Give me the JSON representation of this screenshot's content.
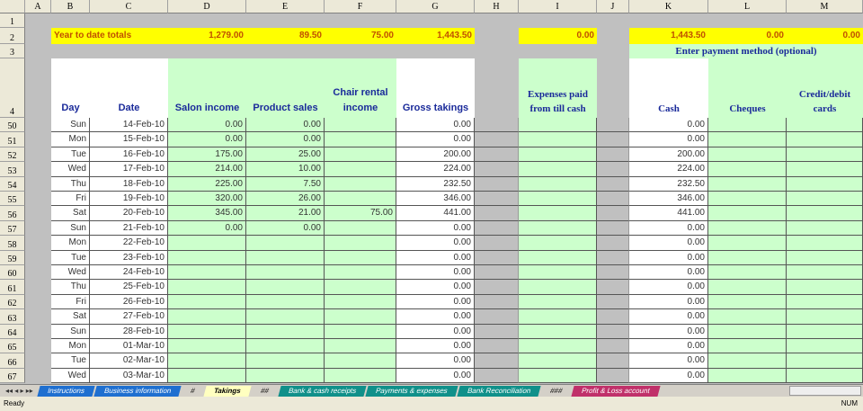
{
  "columns": [
    "A",
    "B",
    "C",
    "D",
    "E",
    "F",
    "G",
    "H",
    "I",
    "J",
    "K",
    "L",
    "M"
  ],
  "totals": {
    "label": "Year to date totals",
    "salon": "1,279.00",
    "product": "89.50",
    "chair": "75.00",
    "gross": "1,443.50",
    "expenses": "0.00",
    "cash": "1,443.50",
    "cheques": "0.00",
    "cards": "0.00"
  },
  "payment_note": "Enter payment method (optional)",
  "headers": {
    "day": "Day",
    "date": "Date",
    "salon": "Salon income",
    "product": "Product sales",
    "chair": "Chair rental income",
    "gross": "Gross takings",
    "expenses": "Expenses paid from till cash",
    "cash": "Cash",
    "cheques": "Cheques",
    "cards": "Credit/debit cards"
  },
  "header_row_numbers": [
    "1",
    "2",
    "3",
    "4"
  ],
  "rows": [
    {
      "n": "50",
      "day": "Sun",
      "date": "14-Feb-10",
      "salon": "0.00",
      "product": "0.00",
      "chair": "",
      "gross": "0.00",
      "cash": "0.00"
    },
    {
      "n": "51",
      "day": "Mon",
      "date": "15-Feb-10",
      "salon": "0.00",
      "product": "0.00",
      "chair": "",
      "gross": "0.00",
      "cash": "0.00"
    },
    {
      "n": "52",
      "day": "Tue",
      "date": "16-Feb-10",
      "salon": "175.00",
      "product": "25.00",
      "chair": "",
      "gross": "200.00",
      "cash": "200.00"
    },
    {
      "n": "53",
      "day": "Wed",
      "date": "17-Feb-10",
      "salon": "214.00",
      "product": "10.00",
      "chair": "",
      "gross": "224.00",
      "cash": "224.00"
    },
    {
      "n": "54",
      "day": "Thu",
      "date": "18-Feb-10",
      "salon": "225.00",
      "product": "7.50",
      "chair": "",
      "gross": "232.50",
      "cash": "232.50"
    },
    {
      "n": "55",
      "day": "Fri",
      "date": "19-Feb-10",
      "salon": "320.00",
      "product": "26.00",
      "chair": "",
      "gross": "346.00",
      "cash": "346.00"
    },
    {
      "n": "56",
      "day": "Sat",
      "date": "20-Feb-10",
      "salon": "345.00",
      "product": "21.00",
      "chair": "75.00",
      "gross": "441.00",
      "cash": "441.00"
    },
    {
      "n": "57",
      "day": "Sun",
      "date": "21-Feb-10",
      "salon": "0.00",
      "product": "0.00",
      "chair": "",
      "gross": "0.00",
      "cash": "0.00"
    },
    {
      "n": "58",
      "day": "Mon",
      "date": "22-Feb-10",
      "salon": "",
      "product": "",
      "chair": "",
      "gross": "0.00",
      "cash": "0.00"
    },
    {
      "n": "59",
      "day": "Tue",
      "date": "23-Feb-10",
      "salon": "",
      "product": "",
      "chair": "",
      "gross": "0.00",
      "cash": "0.00"
    },
    {
      "n": "60",
      "day": "Wed",
      "date": "24-Feb-10",
      "salon": "",
      "product": "",
      "chair": "",
      "gross": "0.00",
      "cash": "0.00"
    },
    {
      "n": "61",
      "day": "Thu",
      "date": "25-Feb-10",
      "salon": "",
      "product": "",
      "chair": "",
      "gross": "0.00",
      "cash": "0.00"
    },
    {
      "n": "62",
      "day": "Fri",
      "date": "26-Feb-10",
      "salon": "",
      "product": "",
      "chair": "",
      "gross": "0.00",
      "cash": "0.00"
    },
    {
      "n": "63",
      "day": "Sat",
      "date": "27-Feb-10",
      "salon": "",
      "product": "",
      "chair": "",
      "gross": "0.00",
      "cash": "0.00"
    },
    {
      "n": "64",
      "day": "Sun",
      "date": "28-Feb-10",
      "salon": "",
      "product": "",
      "chair": "",
      "gross": "0.00",
      "cash": "0.00"
    },
    {
      "n": "65",
      "day": "Mon",
      "date": "01-Mar-10",
      "salon": "",
      "product": "",
      "chair": "",
      "gross": "0.00",
      "cash": "0.00"
    },
    {
      "n": "66",
      "day": "Tue",
      "date": "02-Mar-10",
      "salon": "",
      "product": "",
      "chair": "",
      "gross": "0.00",
      "cash": "0.00"
    },
    {
      "n": "67",
      "day": "Wed",
      "date": "03-Mar-10",
      "salon": "",
      "product": "",
      "chair": "",
      "gross": "0.00",
      "cash": "0.00"
    }
  ],
  "tabs": [
    {
      "label": "Instructions",
      "color": "#1f6fd0"
    },
    {
      "label": "Business information",
      "color": "#1f6fd0"
    },
    {
      "label": "#",
      "color": "#d4d0c8"
    },
    {
      "label": "Takings",
      "color": "#ffffff",
      "active": true
    },
    {
      "label": "##",
      "color": "#d4d0c8"
    },
    {
      "label": "Bank & cash receipts",
      "color": "#10908a"
    },
    {
      "label": "Payments & expenses",
      "color": "#10908a"
    },
    {
      "label": "Bank Reconciliation",
      "color": "#10908a"
    },
    {
      "label": "###",
      "color": "#d4d0c8"
    },
    {
      "label": "Profit & Loss account",
      "color": "#c0306a"
    }
  ],
  "status": {
    "left": "Ready",
    "right": "NUM"
  }
}
